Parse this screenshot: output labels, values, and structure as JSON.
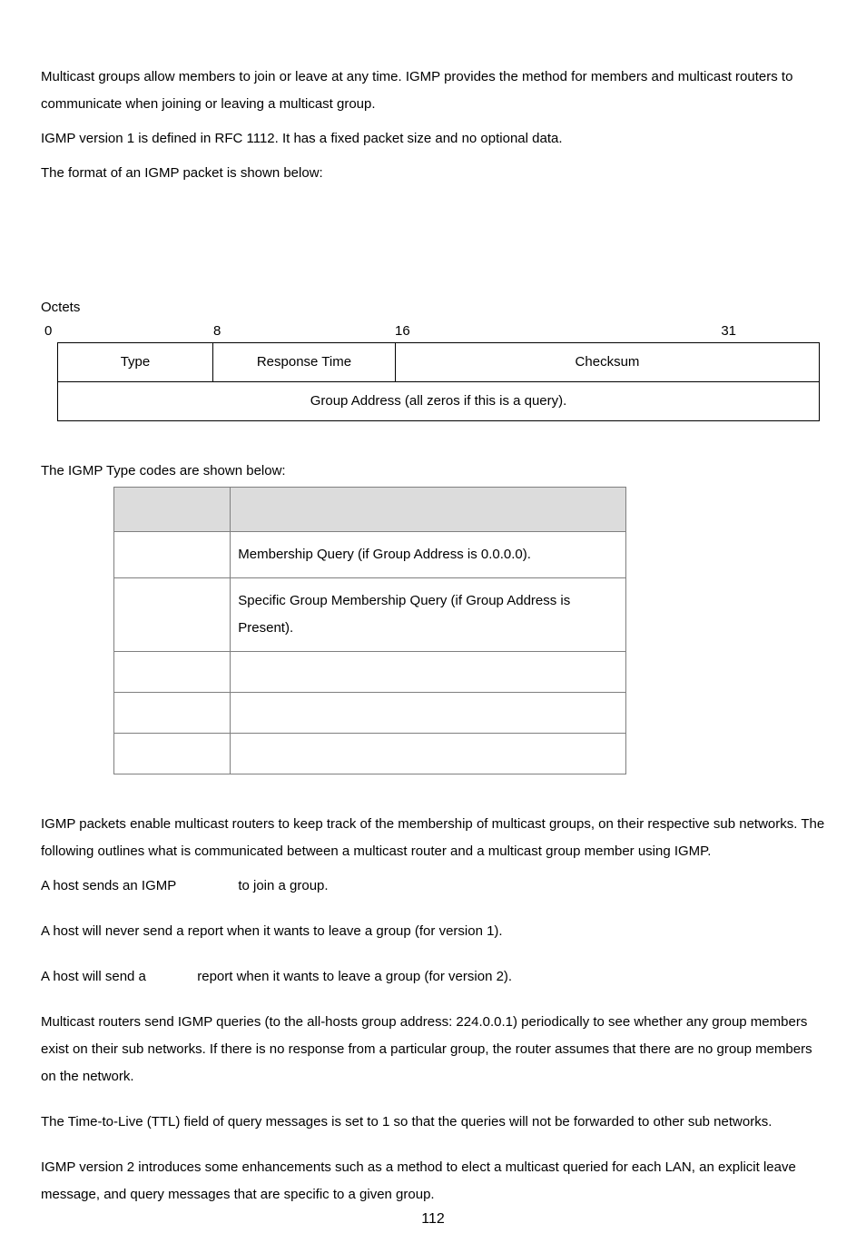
{
  "intro": {
    "p1": "Multicast groups allow members to join or leave at any time. IGMP provides the method for members and multicast routers to communicate when joining or leaving a multicast group.",
    "p2": "IGMP version 1 is defined in RFC 1112. It has a fixed packet size and no optional data.",
    "p3": "The format of an IGMP packet is shown below:"
  },
  "octets_label": "Octets",
  "scale": {
    "a": "0",
    "b": "8",
    "c": "16",
    "d": "31"
  },
  "packet": {
    "type": "Type",
    "resp_time": "Response Time",
    "checksum": "Checksum",
    "group_row": "Group Address (all zeros if this is a query)."
  },
  "typecodes_heading": "The IGMP Type codes are shown below:",
  "typecodes": {
    "header": {
      "code": "",
      "meaning": ""
    },
    "rows": [
      {
        "code": "",
        "meaning": "Membership Query (if Group Address is 0.0.0.0)."
      },
      {
        "code": "",
        "meaning": "Specific Group Membership Query (if Group Address is Present)."
      },
      {
        "code": "",
        "meaning": ""
      },
      {
        "code": "",
        "meaning": ""
      },
      {
        "code": "",
        "meaning": ""
      }
    ]
  },
  "body": {
    "p1": "IGMP packets enable multicast routers to keep track of the membership of multicast groups, on their respective sub networks. The following outlines what is communicated between a multicast router and a multicast group member using IGMP.",
    "p2a": "A host sends an IGMP ",
    "p2b": " to join a group.",
    "p3": "A host will never send a report when it wants to leave a group (for version 1).",
    "p4a": "A host will send a ",
    "p4b": " report when it wants to leave a group (for version 2).",
    "p5": "Multicast routers send IGMP queries (to the all-hosts group address: 224.0.0.1) periodically to see whether any group members exist on their sub networks. If there is no response from a particular group, the router assumes that there are no group members on the network.",
    "p6": "The Time-to-Live (TTL) field of query messages is set to 1 so that the queries will not be forwarded to other sub networks.",
    "p7": "IGMP version 2 introduces some enhancements such as a method to elect a multicast queried for each LAN, an explicit leave message, and query messages that are specific to a given group."
  },
  "pagenum": "112"
}
